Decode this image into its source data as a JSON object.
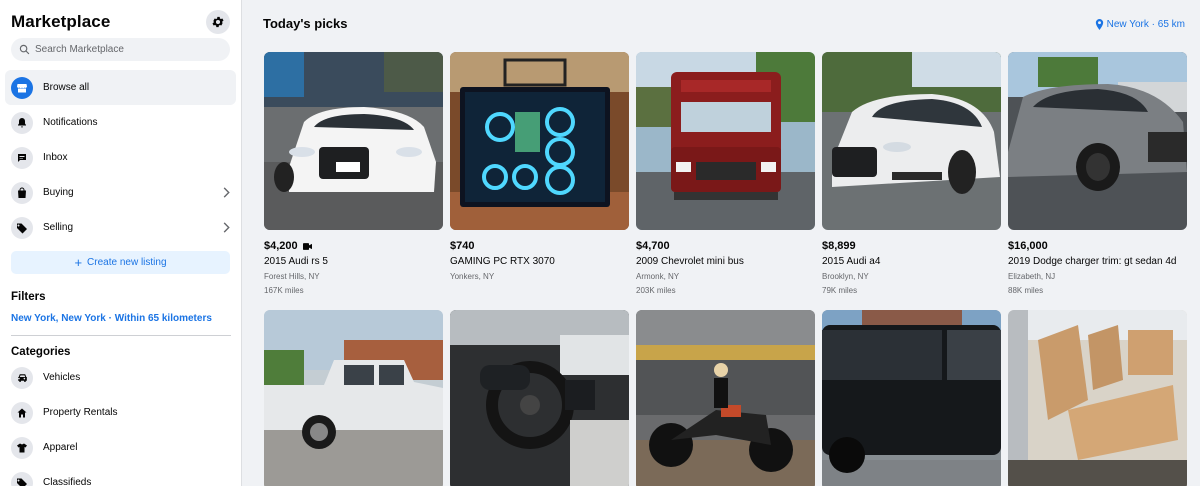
{
  "sidebar": {
    "title": "Marketplace",
    "search_placeholder": "Search Marketplace",
    "nav": [
      {
        "label": "Browse all",
        "icon": "storefront-icon"
      },
      {
        "label": "Notifications",
        "icon": "bell-icon"
      },
      {
        "label": "Inbox",
        "icon": "messenger-icon"
      },
      {
        "label": "Buying",
        "icon": "shopping-bag-icon"
      },
      {
        "label": "Selling",
        "icon": "tag-icon"
      }
    ],
    "create_listing": "Create new listing",
    "filters_title": "Filters",
    "filters_location": "New York, New York · Within 65 kilometers",
    "categories_title": "Categories",
    "categories": [
      {
        "label": "Vehicles",
        "icon": "car-icon"
      },
      {
        "label": "Property Rentals",
        "icon": "house-icon"
      },
      {
        "label": "Apparel",
        "icon": "shirt-icon"
      },
      {
        "label": "Classifieds",
        "icon": "tag-icon"
      }
    ]
  },
  "main": {
    "title": "Today's picks",
    "location": "New York · 65 km",
    "listings_row1": [
      {
        "price": "$4,200",
        "title": "2015 Audi rs 5",
        "location": "Forest Hills, NY",
        "miles": "167K miles",
        "has_video": true
      },
      {
        "price": "$740",
        "title": "GAMING PC RTX 3070",
        "location": "Yonkers, NY",
        "miles": "",
        "has_video": false
      },
      {
        "price": "$4,700",
        "title": "2009 Chevrolet mini bus",
        "location": "Armonk, NY",
        "miles": "203K miles",
        "has_video": false
      },
      {
        "price": "$8,899",
        "title": "2015 Audi a4",
        "location": "Brooklyn, NY",
        "miles": "79K miles",
        "has_video": false
      },
      {
        "price": "$16,000",
        "title": "2019 Dodge charger trim: gt sedan 4d",
        "location": "Elizabeth, NJ",
        "miles": "88K miles",
        "has_video": false
      }
    ]
  }
}
